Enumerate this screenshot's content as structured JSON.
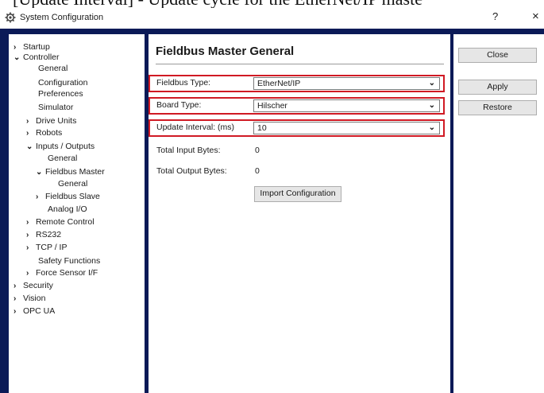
{
  "caption": "[Update Interval] - Update cycle for the EtherNet/IP maste",
  "window": {
    "title": "System Configuration",
    "help_label": "?",
    "close_label": "×"
  },
  "tree": [
    {
      "label": "Startup",
      "chevron": "›",
      "level": 0
    },
    {
      "label": "Controller",
      "chevron": "⌄",
      "level": 0
    },
    {
      "label": "General",
      "chevron": "",
      "level": 1
    },
    {
      "label": "Configuration",
      "chevron": "",
      "level": 1
    },
    {
      "label": "Preferences",
      "chevron": "",
      "level": 1
    },
    {
      "label": "Simulator",
      "chevron": "",
      "level": 1
    },
    {
      "label": "Drive Units",
      "chevron": "›",
      "level": 1
    },
    {
      "label": "Robots",
      "chevron": "›",
      "level": 1
    },
    {
      "label": "Inputs / Outputs",
      "chevron": "⌄",
      "level": 1
    },
    {
      "label": "General",
      "chevron": "",
      "level": 2
    },
    {
      "label": "Fieldbus Master",
      "chevron": "⌄",
      "level": 2
    },
    {
      "label": "General",
      "chevron": "",
      "level": 3
    },
    {
      "label": "Fieldbus Slave",
      "chevron": "›",
      "level": 2
    },
    {
      "label": "Analog I/O",
      "chevron": "",
      "level": 2
    },
    {
      "label": "Remote Control",
      "chevron": "›",
      "level": 1
    },
    {
      "label": "RS232",
      "chevron": "›",
      "level": 1
    },
    {
      "label": "TCP / IP",
      "chevron": "›",
      "level": 1
    },
    {
      "label": "Safety Functions",
      "chevron": "",
      "level": 1
    },
    {
      "label": "Force Sensor I/F",
      "chevron": "›",
      "level": 1
    },
    {
      "label": "Security",
      "chevron": "›",
      "level": 0
    },
    {
      "label": "Vision",
      "chevron": "›",
      "level": 0
    },
    {
      "label": "OPC UA",
      "chevron": "›",
      "level": 0
    }
  ],
  "panel": {
    "heading": "Fieldbus Master General",
    "fieldbus_type": {
      "label": "Fieldbus Type:",
      "value": "EtherNet/IP"
    },
    "board_type": {
      "label": "Board Type:",
      "value": "Hilscher"
    },
    "update_interval": {
      "label": "Update Interval: (ms)",
      "value": "10"
    },
    "total_input": {
      "label": "Total Input Bytes:",
      "value": "0"
    },
    "total_output": {
      "label": "Total Output Bytes:",
      "value": "0"
    },
    "import_button": "Import Configuration"
  },
  "buttons": {
    "close": "Close",
    "apply": "Apply",
    "restore": "Restore"
  },
  "colors": {
    "frame": "#0b1a57",
    "highlight": "#d01a24"
  }
}
